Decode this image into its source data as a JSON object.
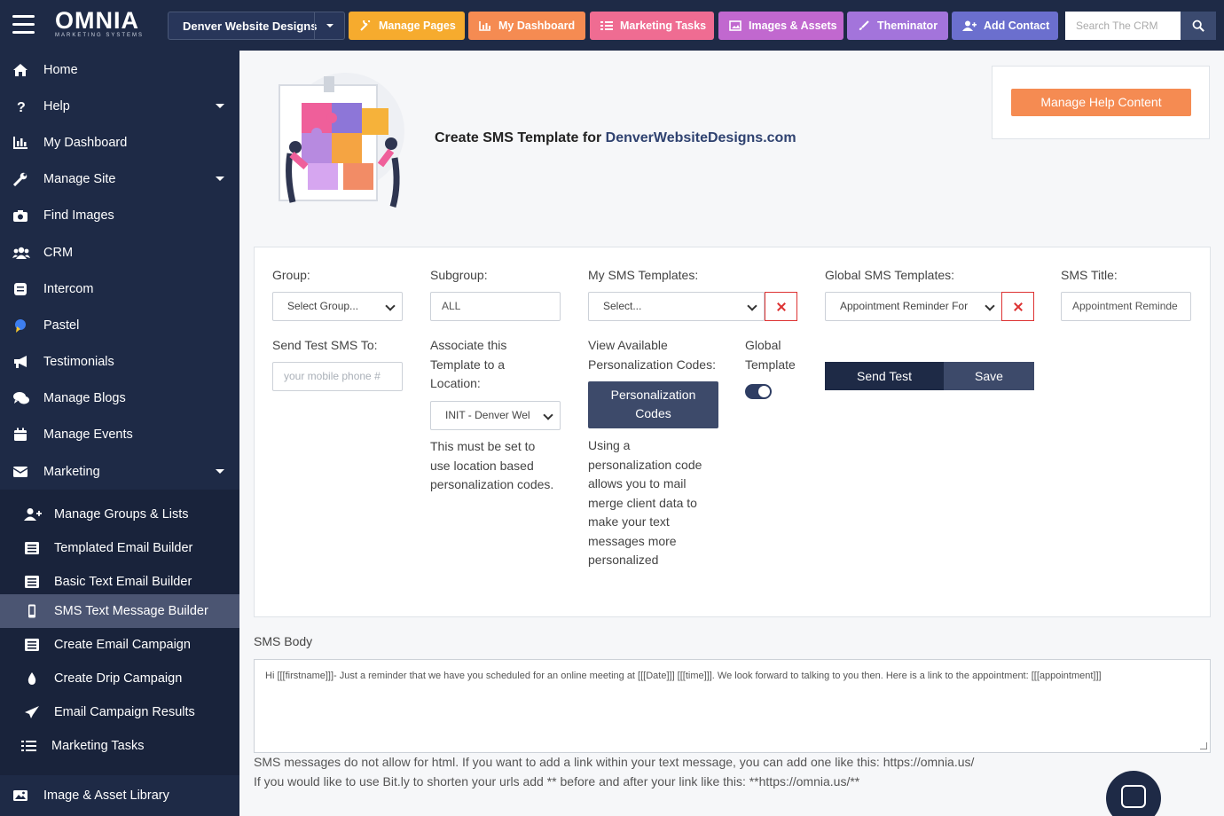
{
  "topbar": {
    "logo_main": "OMNIA",
    "logo_sub": "MARKETING SYSTEMS",
    "site_selector": "Denver Website Designs",
    "buttons": [
      {
        "label": "Manage Pages",
        "color": "#f6ab2e"
      },
      {
        "label": "My Dashboard",
        "color": "#f58b52"
      },
      {
        "label": "Marketing Tasks",
        "color": "#ef6c92"
      },
      {
        "label": "Images & Assets",
        "color": "#c168cf"
      },
      {
        "label": "Theminator",
        "color": "#a374db"
      },
      {
        "label": "Add Contact",
        "color": "#6b6fce"
      }
    ],
    "search_placeholder": "Search The CRM"
  },
  "sidebar": {
    "items": [
      {
        "label": "Home",
        "icon": "home-icon"
      },
      {
        "label": "Help",
        "icon": "question-icon",
        "has_submenu": true
      },
      {
        "label": "My Dashboard",
        "icon": "chart-icon"
      },
      {
        "label": "Manage Site",
        "icon": "wrench-icon",
        "has_submenu": true
      },
      {
        "label": "Find Images",
        "icon": "camera-icon"
      },
      {
        "label": "CRM",
        "icon": "users-icon"
      },
      {
        "label": "Intercom",
        "icon": "chat-icon"
      },
      {
        "label": "Pastel",
        "icon": "pastel-icon"
      },
      {
        "label": "Testimonials",
        "icon": "megaphone-icon"
      },
      {
        "label": "Manage Blogs",
        "icon": "comments-icon"
      },
      {
        "label": "Manage Events",
        "icon": "calendar-icon"
      },
      {
        "label": "Marketing",
        "icon": "envelope-icon",
        "has_submenu": true
      }
    ],
    "marketing_submenu": [
      {
        "label": "Manage Groups & Lists",
        "icon": "user-plus-icon"
      },
      {
        "label": "Templated Email Builder",
        "icon": "list-icon"
      },
      {
        "label": "Basic Text Email Builder",
        "icon": "list-icon"
      },
      {
        "label": "SMS Text Message Builder",
        "icon": "mobile-icon",
        "active": true
      },
      {
        "label": "Create Email Campaign",
        "icon": "list-icon"
      },
      {
        "label": "Create Drip Campaign",
        "icon": "drop-icon"
      },
      {
        "label": "Email Campaign Results",
        "icon": "paper-plane-icon"
      },
      {
        "label": "Marketing Tasks",
        "icon": "tasks-icon"
      }
    ],
    "bottom_item": {
      "label": "Image & Asset Library",
      "icon": "image-icon"
    }
  },
  "header": {
    "title_prefix": "Create SMS Template for",
    "title_domain": "DenverWebsiteDesigns.com",
    "help_button": "Manage Help Content"
  },
  "form": {
    "group_label": "Group:",
    "group_value": "Select Group...",
    "subgroup_label": "Subgroup:",
    "subgroup_value": "ALL",
    "my_templates_label": "My SMS Templates:",
    "my_templates_value": "Select...",
    "global_templates_label": "Global SMS Templates:",
    "global_templates_value": "Appointment Reminder For",
    "sms_title_label": "SMS Title:",
    "sms_title_value": "Appointment Reminde",
    "send_test_label": "Send Test SMS To:",
    "send_test_placeholder": "your mobile phone #",
    "associate_label_1": "Associate this",
    "associate_label_2": "Template to a",
    "associate_label_3": "Location:",
    "location_value": "INIT - Denver Wel",
    "location_note_1": "This must be set to",
    "location_note_2": "use location based",
    "location_note_3": "personalization codes.",
    "codes_label_1": "View Available",
    "codes_label_2": "Personalization Codes:",
    "codes_button_1": "Personalization",
    "codes_button_2": "Codes",
    "codes_note": [
      "Using a",
      "personalization code",
      "allows you to mail",
      "merge client data to",
      "make your text",
      "messages more",
      "personalized"
    ],
    "global_label_1": "Global",
    "global_label_2": "Template",
    "global_toggle_on": true,
    "send_test_button": "Send Test",
    "save_button": "Save"
  },
  "sms": {
    "label": "SMS Body",
    "body": "Hi [[[firstname]]]- Just a reminder that we have you scheduled for an online meeting at [[[Date]]] [[[time]]]. We look forward to talking to you then. Here is a link to the appointment: [[[appointment]]]",
    "note_1": "SMS messages do not allow for html. If you want to add a link within your text message, you can add one like this: https://omnia.us/",
    "note_2": "If you would like to use Bit.ly to shorten your urls add ** before and after your link like this: **https://omnia.us/**"
  }
}
